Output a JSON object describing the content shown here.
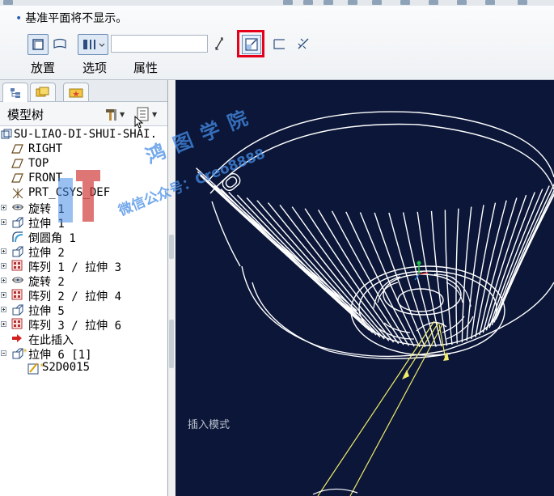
{
  "message": "基准平面将不显示。",
  "dashboard_tabs": [
    "放置",
    "选项",
    "属性"
  ],
  "depth_value": "",
  "tree": {
    "title": "模型树",
    "items": [
      {
        "label": "SU-LIAO-DI-SHUI-SHAI.",
        "icon": "part-icon",
        "expander": ""
      },
      {
        "label": "RIGHT",
        "icon": "datum-plane-icon",
        "expander": ""
      },
      {
        "label": "TOP",
        "icon": "datum-plane-icon",
        "expander": ""
      },
      {
        "label": "FRONT",
        "icon": "datum-plane-icon",
        "expander": ""
      },
      {
        "label": "PRT_CSYS_DEF",
        "icon": "csys-icon",
        "expander": ""
      },
      {
        "label": "旋转 1",
        "icon": "revolve-icon",
        "expander": "plus"
      },
      {
        "label": "拉伸 1",
        "icon": "extrude-icon",
        "expander": "plus"
      },
      {
        "label": "倒圆角 1",
        "icon": "round-icon",
        "expander": ""
      },
      {
        "label": "拉伸 2",
        "icon": "extrude-icon",
        "expander": "plus"
      },
      {
        "label": "阵列 1 / 拉伸 3",
        "icon": "pattern-icon",
        "expander": "plus"
      },
      {
        "label": "旋转 2",
        "icon": "revolve-icon",
        "expander": "plus"
      },
      {
        "label": "阵列 2 / 拉伸 4",
        "icon": "pattern-icon",
        "expander": "plus"
      },
      {
        "label": "拉伸 5",
        "icon": "extrude-icon",
        "expander": "plus"
      },
      {
        "label": "阵列 3 / 拉伸 6",
        "icon": "pattern-icon",
        "expander": "plus"
      },
      {
        "label": "在此插入",
        "icon": "insert-arrow-icon",
        "expander": ""
      },
      {
        "label": "拉伸 6 [1]",
        "icon": "extrude-active-icon",
        "expander": "minus"
      },
      {
        "label": "S2D0015",
        "icon": "sketch-icon",
        "expander": ""
      }
    ]
  },
  "viewport": {
    "mode_label": "插入模式",
    "background": "#0b1638"
  },
  "watermark": {
    "line1": "鸿 图 学 院",
    "line2": "微信公众号：Creo8888"
  },
  "colors": {
    "highlight": "#e5001b",
    "accent": "#2a63b6"
  }
}
